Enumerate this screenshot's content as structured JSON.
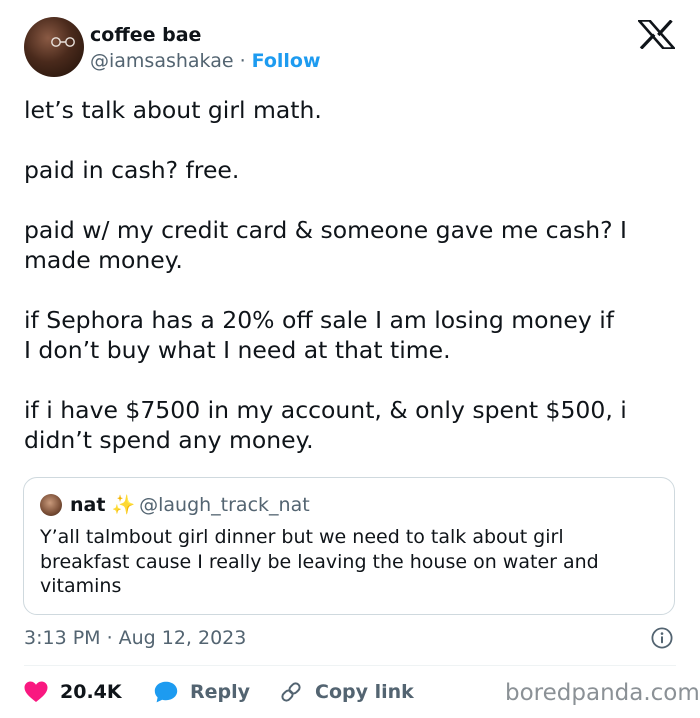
{
  "author": {
    "display_name": "coffee bae",
    "handle": "@iamsashakae",
    "separator": "·",
    "follow_label": "Follow"
  },
  "tweet": {
    "paragraphs": [
      "let’s talk about girl math.",
      "paid in cash? free.",
      "paid w/ my credit card & someone gave me cash? I\nmade money.",
      "if Sephora has a 20% off sale I am losing money if\nI don’t buy what I need at that time.",
      "if i have $7500 in my account, & only spent $500, i\ndidn’t spend any money."
    ]
  },
  "quoted_tweet": {
    "name": "nat",
    "emoji": "✨",
    "handle": "@laugh_track_nat",
    "text": "Y’all talmbout girl dinner but we need to talk about girl breakfast cause I really be leaving the house on water and vitamins"
  },
  "meta": {
    "time": "3:13 PM",
    "separator": "·",
    "date": "Aug 12, 2023"
  },
  "actions": {
    "like_count": "20.4K",
    "reply_label": "Reply",
    "copy_link_label": "Copy link"
  },
  "watermark": "boredpanda.com",
  "colors": {
    "accent": "#1d9bf0",
    "like": "#f91880",
    "muted_text": "#536471",
    "border": "#cfd9de"
  },
  "icons": {
    "logo": "x-logo-icon",
    "info": "info-icon",
    "like": "heart-icon",
    "reply": "speech-bubble-icon",
    "copy_link": "link-icon"
  }
}
